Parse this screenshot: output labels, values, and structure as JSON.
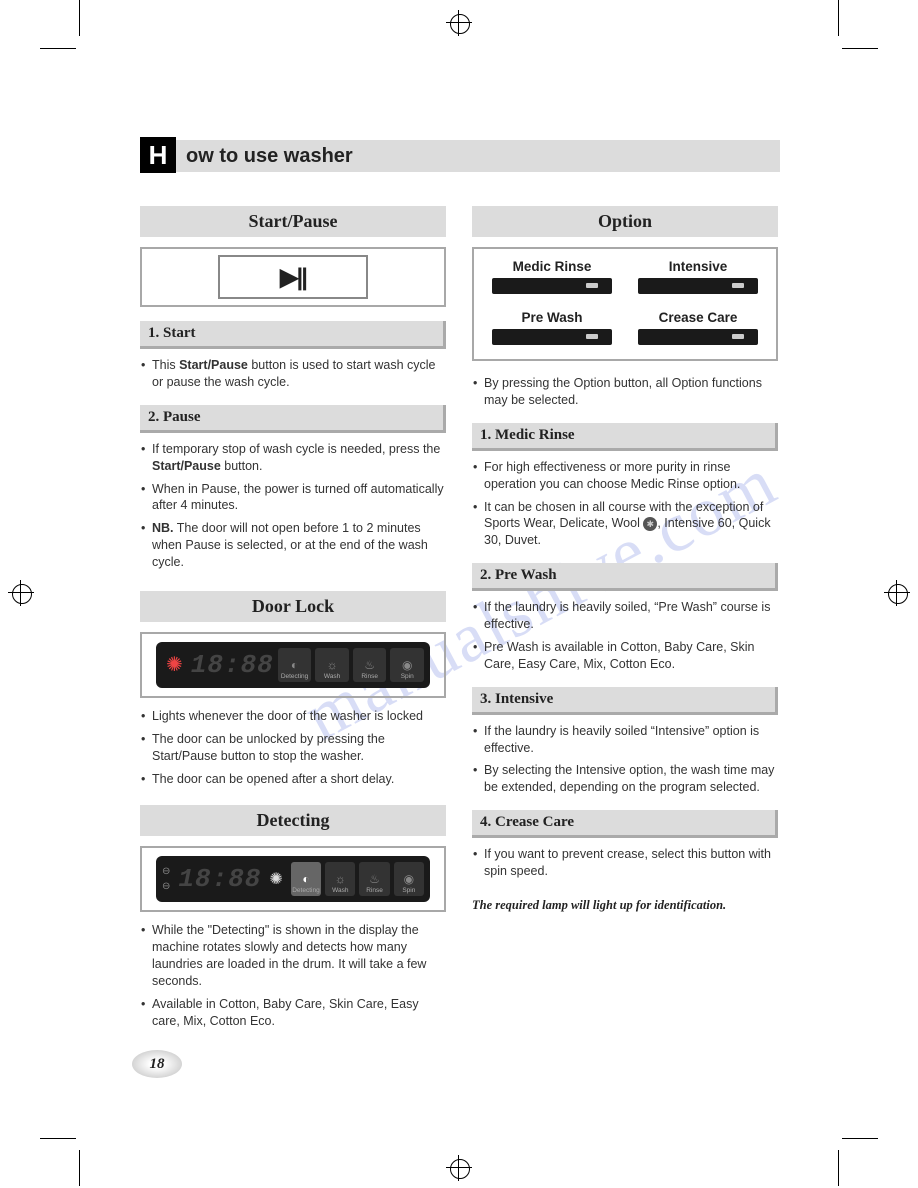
{
  "page_number": "18",
  "watermark": "manualshive.com",
  "title": {
    "badge": "H",
    "rest": "ow to use washer"
  },
  "left": {
    "start_pause": {
      "bar": "Start/Pause",
      "icon": "▶||",
      "h1": "1. Start",
      "s1_b1_pre": "This ",
      "s1_b1_bold": "Start/Pause",
      "s1_b1_post": " button is used  to start wash cycle or pause the wash cycle.",
      "h2": "2. Pause",
      "s2_b1_pre": "If temporary stop of wash cycle is needed, press the ",
      "s2_b1_bold": "Start/Pause",
      "s2_b1_post": " button.",
      "s2_b2": "When in Pause, the power is turned off automatically after 4 minutes.",
      "s2_b3_bold": "NB.",
      "s2_b3_post": " The door will not open before 1 to 2 minutes when Pause is selected, or at the end of the wash cycle."
    },
    "door_lock": {
      "bar": "Door Lock",
      "digits": "18:88",
      "stages": [
        "Detecting",
        "Wash",
        "Rinse",
        "Spin"
      ],
      "b1": "Lights whenever the door of  the washer is locked",
      "b2": "The door can be unlocked by pressing the Start/Pause button to stop the washer.",
      "b3": "The door can be opened after a short delay."
    },
    "detecting": {
      "bar": "Detecting",
      "digits": "18:88",
      "stages": [
        "Detecting",
        "Wash",
        "Rinse",
        "Spin"
      ],
      "b1": "While the \"Detecting\" is shown in the display the machine rotates slowly and detects how many laundries are loaded in the drum. It will take a few seconds.",
      "b2": "Available in Cotton, Baby Care, Skin Care, Easy care, Mix, Cotton Eco."
    }
  },
  "right": {
    "option": {
      "bar": "Option",
      "buttons": [
        "Medic Rinse",
        "Intensive",
        "Pre Wash",
        "Crease Care"
      ],
      "intro": "By pressing the Option button, all Option functions may be selected."
    },
    "medic": {
      "h": "1. Medic Rinse",
      "b1": "For high effectiveness or more purity in rinse operation you can choose Medic Rinse option.",
      "b2_pre": "It can be chosen in all course with the exception of Sports Wear, Delicate, Wool ",
      "b2_post": ", Intensive 60, Quick 30, Duvet."
    },
    "prewash": {
      "h": "2. Pre Wash",
      "b1": "If the laundry is heavily soiled, “Pre Wash” course is effective.",
      "b2": "Pre Wash is available in Cotton, Baby Care, Skin Care, Easy Care, Mix, Cotton Eco."
    },
    "intensive": {
      "h": "3. Intensive",
      "b1": "If the laundry is heavily soiled “Intensive” option is effective.",
      "b2": "By selecting the Intensive option, the wash time may be extended, depending on the program selected."
    },
    "crease": {
      "h": "4. Crease Care",
      "b1": "If you want to prevent crease, select this button with spin speed."
    },
    "note": "The required lamp will light up for identification."
  }
}
